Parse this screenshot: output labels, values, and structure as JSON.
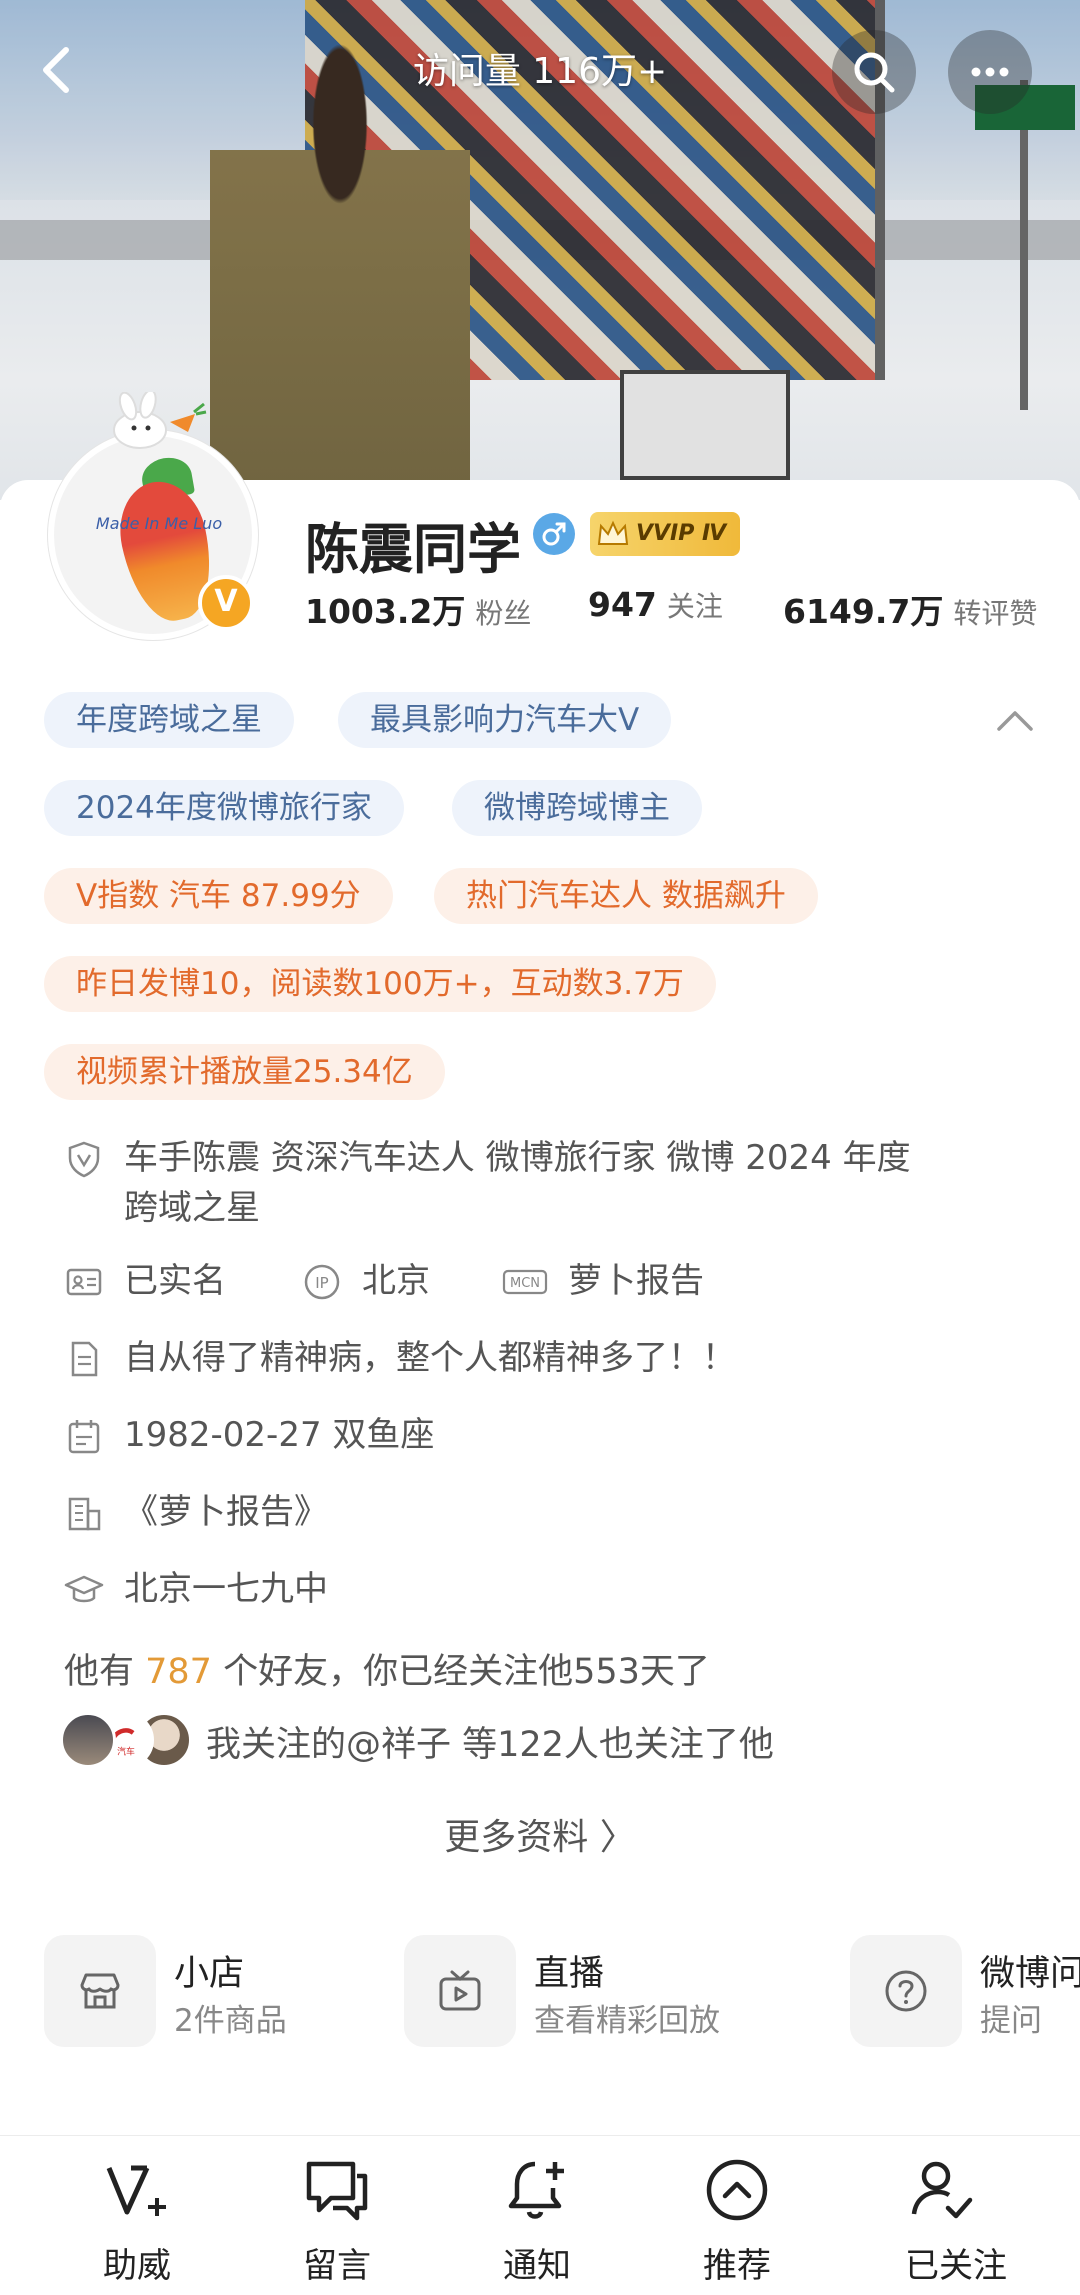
{
  "header": {
    "visits_label": "访问量 116万+"
  },
  "profile": {
    "name": "陈震同学",
    "vvip_label": "VVIP Ⅳ",
    "avatar_text": "Made In Me Luo",
    "verify_badge": "V",
    "stats": [
      {
        "num": "1003.2万",
        "label": "粉丝"
      },
      {
        "num": "947",
        "label": "关注"
      },
      {
        "num": "6149.7万",
        "label": "转评赞"
      }
    ]
  },
  "tags": {
    "blue": [
      "年度跨域之星",
      "最具影响力汽车大V",
      "2024年度微博旅行家",
      "微博跨域博主"
    ],
    "orange": [
      "V指数 汽车 87.99分",
      "热门汽车达人 数据飙升",
      "昨日发博10，阅读数100万+，互动数3.7万",
      "视频累计播放量25.34亿"
    ]
  },
  "info": {
    "verification_line1": "车手陈震 资深汽车达人  微博旅行家 微博 2024 年度",
    "verification_line2": "跨域之星",
    "realname": "已实名",
    "ip": "北京",
    "mcn": "萝卜报告",
    "bio": "自从得了精神病，整个人都精神多了！！",
    "birthday": "1982-02-27 双鱼座",
    "company": "《萝卜报告》",
    "school": "北京一七九中"
  },
  "friends": {
    "prefix": "他有 ",
    "count": "787",
    "suffix": " 个好友，你已经关注他553天了"
  },
  "followed_by": "我关注的@祥子 等122人也关注了他",
  "more_info": "更多资料 〉",
  "services": [
    {
      "title": "小店",
      "sub": "2件商品"
    },
    {
      "title": "直播",
      "sub": "查看精彩回放"
    },
    {
      "title": "微博问",
      "sub": "提问"
    }
  ],
  "tabbar": [
    "助威",
    "留言",
    "通知",
    "推荐",
    "已关注"
  ],
  "colors": {
    "tag_blue_bg": "#eef3fb",
    "tag_orange_bg": "#fdf0e8",
    "friend_count": "#e39a37",
    "vvip_gold": "#f0b93a"
  }
}
